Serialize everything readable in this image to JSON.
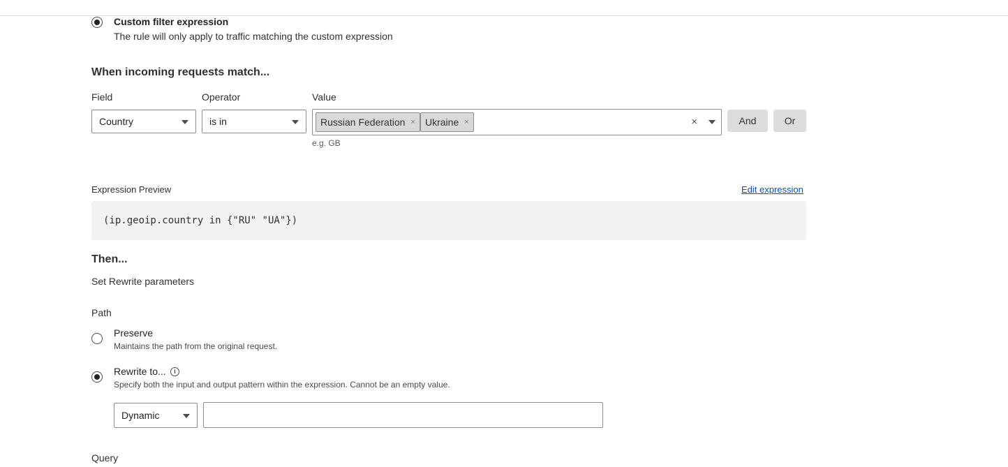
{
  "filter": {
    "custom_title": "Custom filter expression",
    "custom_desc": "The rule will only apply to traffic matching the custom expression"
  },
  "match": {
    "heading": "When incoming requests match...",
    "field_label": "Field",
    "operator_label": "Operator",
    "value_label": "Value",
    "field_value": "Country",
    "operator_value": "is in",
    "chips": [
      "Russian Federation",
      "Ukraine"
    ],
    "chip_remove": "×",
    "clear": "×",
    "hint": "e.g. GB",
    "and_label": "And",
    "or_label": "Or"
  },
  "preview": {
    "label": "Expression Preview",
    "edit_link": "Edit expression",
    "expression": "(ip.geoip.country in {\"RU\" \"UA\"})"
  },
  "then": {
    "heading": "Then...",
    "subtitle": "Set Rewrite parameters"
  },
  "path": {
    "label": "Path",
    "preserve_title": "Preserve",
    "preserve_desc": "Maintains the path from the original request.",
    "rewrite_title": "Rewrite to...",
    "rewrite_desc": "Specify both the input and output pattern within the expression. Cannot be an empty value.",
    "mode_value": "Dynamic",
    "rewrite_input_value": ""
  },
  "query": {
    "label": "Query"
  },
  "icons": {
    "info": "i"
  }
}
